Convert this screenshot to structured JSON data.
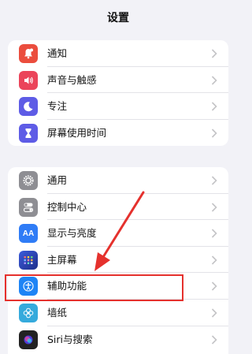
{
  "header": {
    "title": "设置"
  },
  "group1": {
    "items": [
      {
        "label": "通知",
        "icon": "bell-icon",
        "color": "#eb4d3d"
      },
      {
        "label": "声音与触感",
        "icon": "speaker-icon",
        "color": "#eb445a"
      },
      {
        "label": "专注",
        "icon": "moon-icon",
        "color": "#5e5ce6"
      },
      {
        "label": "屏幕使用时间",
        "icon": "hourglass-icon",
        "color": "#5e5ce6"
      }
    ]
  },
  "group2": {
    "items": [
      {
        "label": "通用",
        "icon": "gear-icon",
        "color": "#8e8e93"
      },
      {
        "label": "控制中心",
        "icon": "toggles-icon",
        "color": "#8e8e93"
      },
      {
        "label": "显示与亮度",
        "icon": "text-size-icon",
        "color": "#2f7cf6",
        "icon_text": "AA"
      },
      {
        "label": "主屏幕",
        "icon": "home-grid-icon",
        "color": "#2e4fd1"
      },
      {
        "label": "辅助功能",
        "icon": "accessibility-icon",
        "color": "#1e84f5"
      },
      {
        "label": "墙纸",
        "icon": "flower-icon",
        "color": "#35aadc"
      },
      {
        "label": "Siri与搜索",
        "icon": "siri-icon",
        "color": "#222222"
      }
    ]
  },
  "annotation": {
    "highlight_color": "#e5312d",
    "highlight_target": "辅助功能"
  }
}
